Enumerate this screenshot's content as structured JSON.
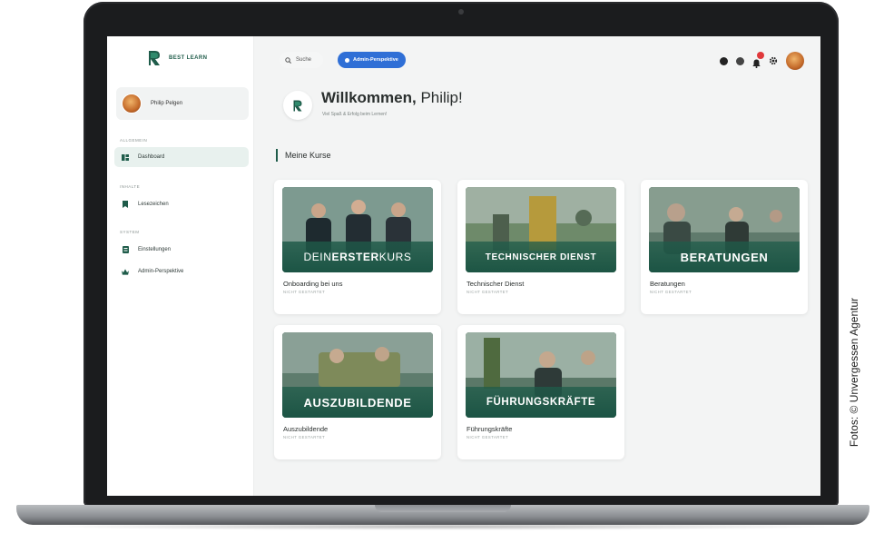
{
  "credit": "Fotos: © Unvergessen Agentur",
  "brand": {
    "name": "BEST LEARN"
  },
  "user": {
    "name": "Philip Pelgen"
  },
  "sidebar": {
    "sections": [
      {
        "label": "ALLGEMEIN",
        "items": [
          {
            "label": "Dashboard",
            "icon": "dashboard-icon",
            "active": true
          }
        ]
      },
      {
        "label": "INHALTE",
        "items": [
          {
            "label": "Lesezeichen",
            "icon": "bookmark-icon",
            "active": false
          }
        ]
      },
      {
        "label": "SYSTEM",
        "items": [
          {
            "label": "Einstellungen",
            "icon": "settings-list-icon",
            "active": false
          },
          {
            "label": "Admin-Perspektive",
            "icon": "crown-icon",
            "active": false
          }
        ]
      }
    ]
  },
  "topbar": {
    "search_label": "Suche",
    "admin_pill": "Admin-Perspektive",
    "notification_count": ""
  },
  "welcome": {
    "title_bold": "Willkommen,",
    "title_name": "Philip!",
    "subtitle": "Viel Spaß & Erfolg beim Lernen!"
  },
  "courses": {
    "heading": "Meine Kurse",
    "items": [
      {
        "banner_pre": "DEIN ",
        "banner_bold": "ERSTER",
        "banner_post": " KURS",
        "title": "Onboarding bei uns",
        "status": "NICHT GESTARTET"
      },
      {
        "banner_pre": "",
        "banner_bold": "TECHNISCHER DIENST",
        "banner_post": "",
        "title": "Technischer Dienst",
        "status": "NICHT GESTARTET"
      },
      {
        "banner_pre": "",
        "banner_bold": "BERATUNGEN",
        "banner_post": "",
        "title": "Beratungen",
        "status": "NICHT GESTARTET"
      },
      {
        "banner_pre": "",
        "banner_bold": "AUSZUBILDENDE",
        "banner_post": "",
        "title": "Auszubildende",
        "status": "NICHT GESTARTET"
      },
      {
        "banner_pre": "",
        "banner_bold": "FÜHRUNGSKRÄFTE",
        "banner_post": "",
        "title": "Führungskräfte",
        "status": "NICHT GESTARTET"
      }
    ]
  },
  "colors": {
    "brand_green": "#1f5c4a",
    "admin_blue": "#2f6fd6",
    "notification_red": "#e0393b"
  }
}
